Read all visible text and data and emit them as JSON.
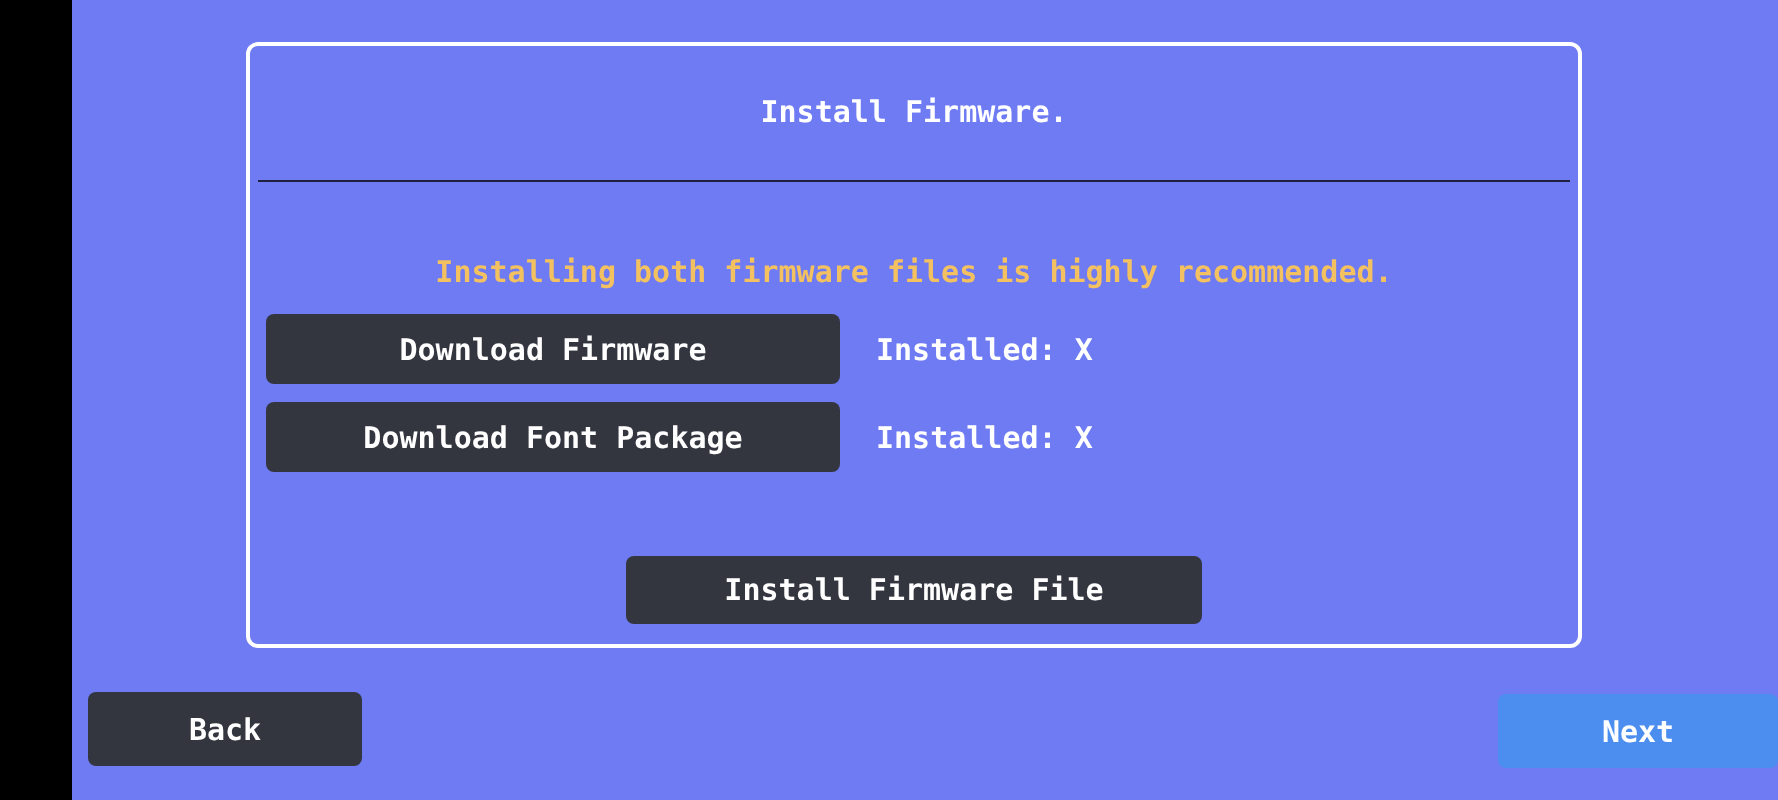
{
  "panel": {
    "title": "Install Firmware.",
    "notice": "Installing both firmware files is highly recommended.",
    "downloads": [
      {
        "label": "Download Firmware",
        "status": "Installed: X"
      },
      {
        "label": "Download Font Package",
        "status": "Installed: X"
      }
    ],
    "install_button": "Install Firmware File"
  },
  "nav_buttons": [
    {
      "label": "Back",
      "highlighted": false
    },
    {
      "label": "Next",
      "highlighted": true
    }
  ]
}
